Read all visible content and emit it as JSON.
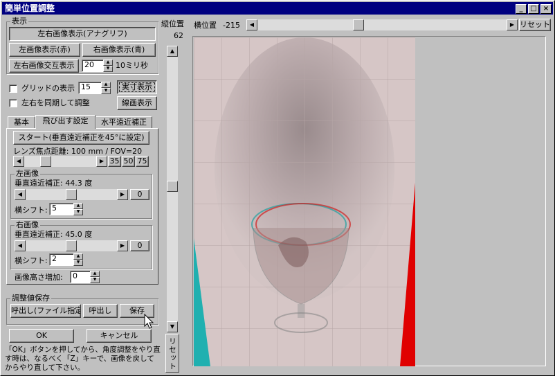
{
  "window": {
    "title": "簡単位置調整",
    "minimize_label": "_",
    "maximize_label": "□",
    "close_label": "×"
  },
  "display": {
    "group_label": "表示",
    "anaglyph_button": "左右画像表示(アナグリフ)",
    "left_red_button": "左画像表示(赤)",
    "right_blue_button": "右画像表示(青)",
    "alternate_button": "左右画像交互表示",
    "alternate_value": "20",
    "alternate_unit": "10ミリ秒"
  },
  "grid": {
    "checkbox_label": "グリッドの表示",
    "value": "15",
    "actual_size_button": "実寸表示",
    "sync_label": "左右を同期して調整",
    "line_draw_button": "線画表示"
  },
  "tabs": [
    {
      "label": "基本"
    },
    {
      "label": "飛び出す設定"
    },
    {
      "label": "水平遠近補正"
    }
  ],
  "pop_settings": {
    "start_button": "スタート(垂直遠近補正を45°に設定)",
    "lens_label": "レンズ焦点距離: 100 mm  /  FOV=20",
    "preset_35": "35",
    "preset_50": "50",
    "preset_75": "75",
    "lens_slider_fraction": 0.26,
    "left_group": "左画像",
    "left_vertical_label": "垂直遠近補正:  44.3 度",
    "left_vertical_fraction": 0.5,
    "left_reset": "0",
    "left_shift_label": "横シフト:",
    "left_shift_value": "5",
    "right_group": "右画像",
    "right_vertical_label": "垂直遠近補正:  45.0 度",
    "right_vertical_fraction": 0.5,
    "right_reset": "0",
    "right_shift_label": "横シフト:",
    "right_shift_value": "2",
    "height_label": "画像高さ増加:",
    "height_value": "0"
  },
  "save_group": {
    "label": "調整値保存",
    "load_file_button": "呼出し(ファイル指定)",
    "load_button": "呼出し",
    "save_button": "保存"
  },
  "ok_button": "OK",
  "cancel_button": "キャンセル",
  "help_text": "「OK」ボタンを押してから、角度調整をやり直す時は、なるべく「Z」キーで、画像を戻してからやり直して下さい。",
  "vertical": {
    "label": "縦位置",
    "value": "62",
    "reset_button": "リセット",
    "slider_fraction": 0.49
  },
  "horizontal": {
    "label": "横位置",
    "value": "-215",
    "reset_button": "リセット",
    "slider_fraction": 0.4
  },
  "colors": {
    "title_bar": "#000080",
    "face": "#c0c0c0",
    "anaglyph_red": "#e00000",
    "anaglyph_cyan": "#20b0b0"
  }
}
